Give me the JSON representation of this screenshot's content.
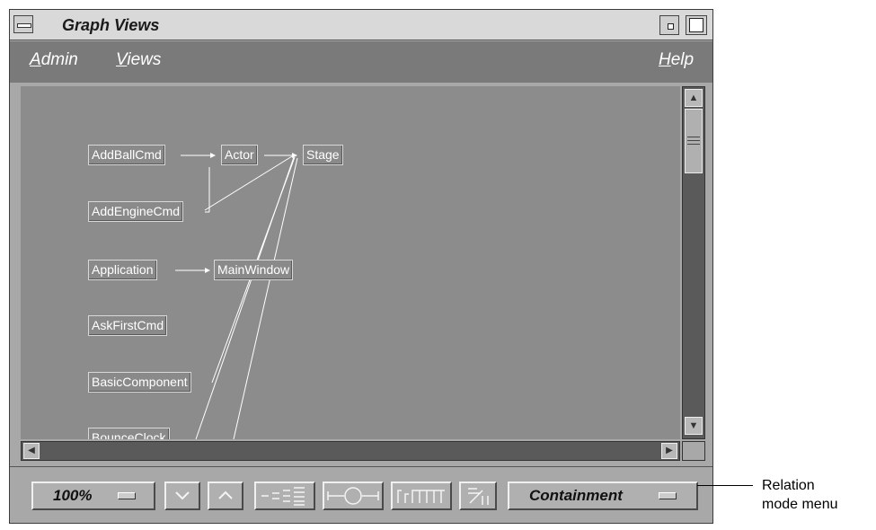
{
  "window": {
    "title": "Graph Views"
  },
  "menubar": {
    "items": [
      {
        "label": "Admin",
        "mnemonic": "A",
        "rest": "dmin"
      },
      {
        "label": "Views",
        "mnemonic": "V",
        "rest": "iews"
      },
      {
        "label": "Help",
        "mnemonic": "H",
        "rest": "elp"
      }
    ]
  },
  "graph": {
    "nodes": [
      {
        "id": "AddBallCmd",
        "label": "AddBallCmd"
      },
      {
        "id": "Actor",
        "label": "Actor"
      },
      {
        "id": "Stage",
        "label": "Stage"
      },
      {
        "id": "AddEngineCmd",
        "label": "AddEngineCmd"
      },
      {
        "id": "Application",
        "label": "Application"
      },
      {
        "id": "MainWindow",
        "label": "MainWindow"
      },
      {
        "id": "AskFirstCmd",
        "label": "AskFirstCmd"
      },
      {
        "id": "BasicComponent",
        "label": "BasicComponent"
      },
      {
        "id": "BounceClock",
        "label": "BounceClock"
      }
    ],
    "edges": [
      [
        "AddBallCmd",
        "Actor"
      ],
      [
        "Actor",
        "Stage"
      ],
      [
        "AddEngineCmd",
        "Actor"
      ],
      [
        "AddEngineCmd",
        "Stage"
      ],
      [
        "Application",
        "MainWindow"
      ],
      [
        "BasicComponent",
        "Stage"
      ],
      [
        "BounceClock",
        "Stage"
      ]
    ]
  },
  "toolbar": {
    "zoom_value": "100%",
    "relation_mode": "Containment",
    "buttons": [
      "collapse-button",
      "expand-button",
      "hierarchy-layout-button",
      "rotate-layout-button",
      "tree-layout-button",
      "overview-button"
    ]
  },
  "annotation": {
    "line1": "Relation",
    "line2": "mode menu"
  },
  "colors": {
    "graph_bg": "#8c8c8c",
    "menubar_bg": "#7a7a7a",
    "window_bg": "#a8a8a8"
  }
}
